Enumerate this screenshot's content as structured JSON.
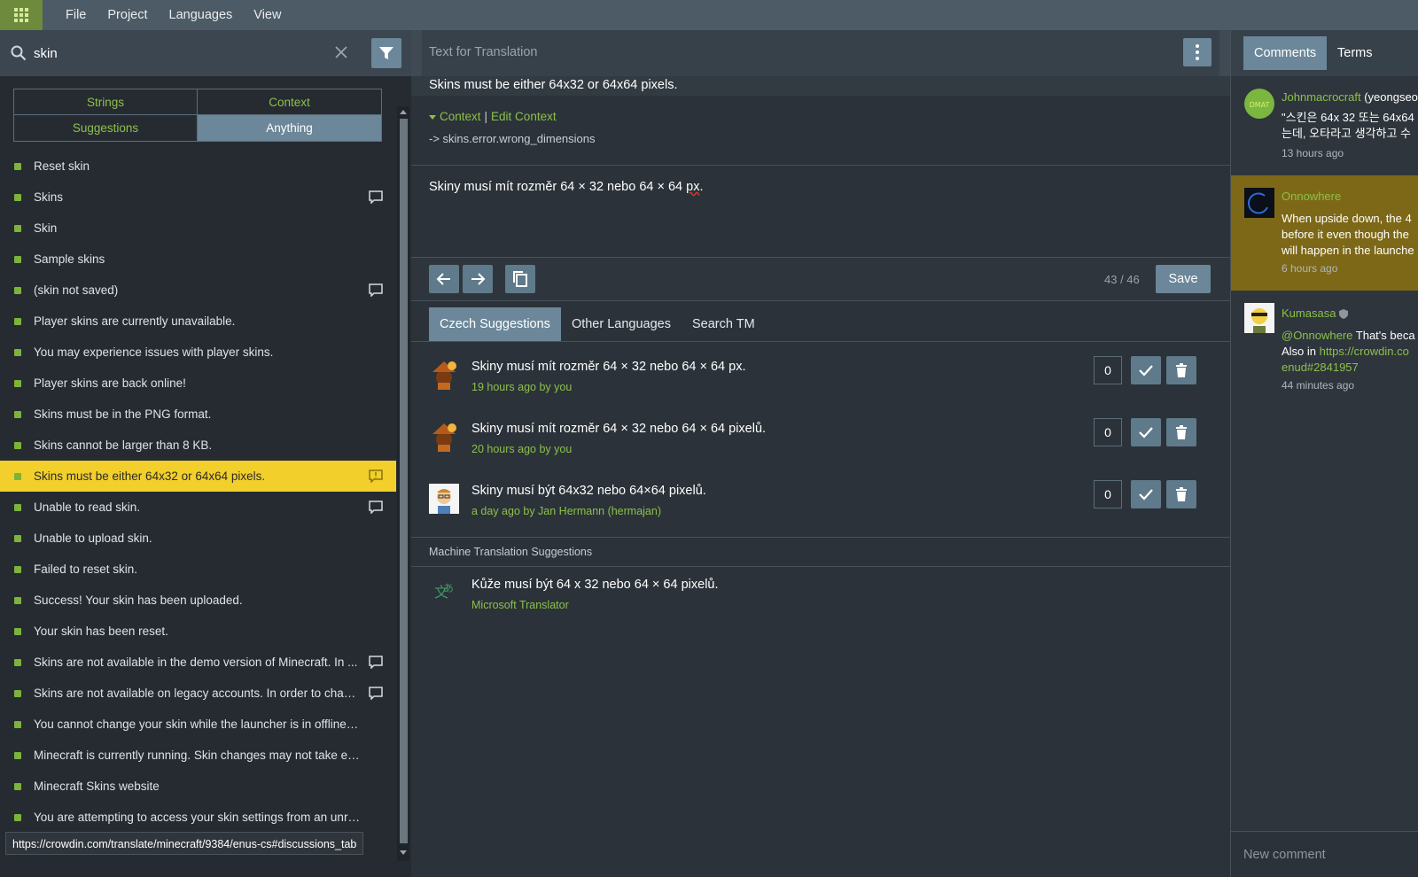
{
  "menu": [
    "File",
    "Project",
    "Languages",
    "View"
  ],
  "search": {
    "value": "skin"
  },
  "filter_tabs": [
    "Strings",
    "Context",
    "Suggestions",
    "Anything"
  ],
  "filter_active": "Anything",
  "strings": [
    {
      "text": "Reset skin",
      "comment": false
    },
    {
      "text": "Skins",
      "comment": true
    },
    {
      "text": "Skin",
      "comment": false
    },
    {
      "text": "Sample skins",
      "comment": false
    },
    {
      "text": "(skin not saved)",
      "comment": true
    },
    {
      "text": "Player skins are currently unavailable.",
      "comment": false
    },
    {
      "text": "You may experience issues with player skins.",
      "comment": false
    },
    {
      "text": "Player skins are back online!",
      "comment": false
    },
    {
      "text": "Skins must be in the PNG format.",
      "comment": false
    },
    {
      "text": "Skins cannot be larger than 8 KB.",
      "comment": false
    },
    {
      "text": "Skins must be either 64x32 or 64x64 pixels.",
      "comment": true,
      "selected": true
    },
    {
      "text": "Unable to read skin.",
      "comment": true
    },
    {
      "text": "Unable to upload skin.",
      "comment": false
    },
    {
      "text": "Failed to reset skin.",
      "comment": false
    },
    {
      "text": "Success! Your skin has been uploaded.",
      "comment": false
    },
    {
      "text": "Your skin has been reset.",
      "comment": false
    },
    {
      "text": "Skins are not available in the demo version of Minecraft. In ...",
      "comment": true
    },
    {
      "text": "Skins are not available on legacy accounts. In order to chan...",
      "comment": true
    },
    {
      "text": "You cannot change your skin while the launcher is in offline mo...",
      "comment": false
    },
    {
      "text": "Minecraft is currently running. Skin changes may not take effec...",
      "comment": false
    },
    {
      "text": "Minecraft Skins website",
      "comment": false
    },
    {
      "text": "You are attempting to access your skin settings from an unreco...",
      "comment": false
    }
  ],
  "status_url": "https://crowdin.com/translate/minecraft/9384/enus-cs#discussions_tab",
  "editor": {
    "header_title": "Text for Translation",
    "source_text": "Skins must be either 64x32 or 64x64 pixels.",
    "context_label": "Context",
    "edit_context_label": "Edit Context",
    "context_key": "-> skins.error.wrong_dimensions",
    "translation": "Skiny musí mít rozměr 64 × 32 nebo 64 × 64 ",
    "translation_spell": "px",
    "translation_end": ".",
    "counter": "43 / 46",
    "save_label": "Save"
  },
  "suggestion_tabs": [
    "Czech Suggestions",
    "Other Languages",
    "Search TM"
  ],
  "suggestions": [
    {
      "text": "Skiny musí mít rozměr 64 × 32 nebo 64 × 64 px.",
      "meta": "19 hours ago by you",
      "votes": "0",
      "avatar": "user"
    },
    {
      "text": "Skiny musí mít rozměr 64 × 32 nebo 64 × 64 pixelů.",
      "meta": "20 hours ago by you",
      "votes": "0",
      "avatar": "user"
    },
    {
      "text": "Skiny musí být 64x32 nebo 64×64 pixelů.",
      "meta": "a day ago by Jan Hermann (hermajan)",
      "votes": "0",
      "avatar": "hermajan"
    }
  ],
  "machine_header": "Machine Translation Suggestions",
  "machine": {
    "text": "Kůže musí být 64 x 32 nebo 64 × 64 pixelů.",
    "meta": "Microsoft Translator"
  },
  "right_tabs": [
    "Comments",
    "Terms"
  ],
  "comments": [
    {
      "user": "Johnmacrocraft",
      "user_extra": " (yeongseo",
      "body": [
        "\"스킨은 64x 32 또는 64x64",
        "는데, 오타라고 생각하고 수"
      ],
      "time": "13 hours ago"
    },
    {
      "user": "Onnowhere",
      "user_extra": "",
      "body": [
        "When upside down, the 4",
        "before it even though the",
        "will happen in the launche"
      ],
      "time": "6 hours ago"
    },
    {
      "user": "Kumasasa",
      "user_extra": "",
      "body_mention": "@Onnowhere",
      "body_after": " That's beca",
      "body2_prefix": "Also in ",
      "body2_link": "https://crowdin.co",
      "body3_link": "enud#2841957",
      "time": "44 minutes ago"
    }
  ],
  "new_comment_placeholder": "New comment",
  "colors": {
    "accent_green": "#8cc04a",
    "selected_yellow": "#f2cf2a",
    "highlight_comment": "#7d6818",
    "button_blue": "#6b8799"
  }
}
